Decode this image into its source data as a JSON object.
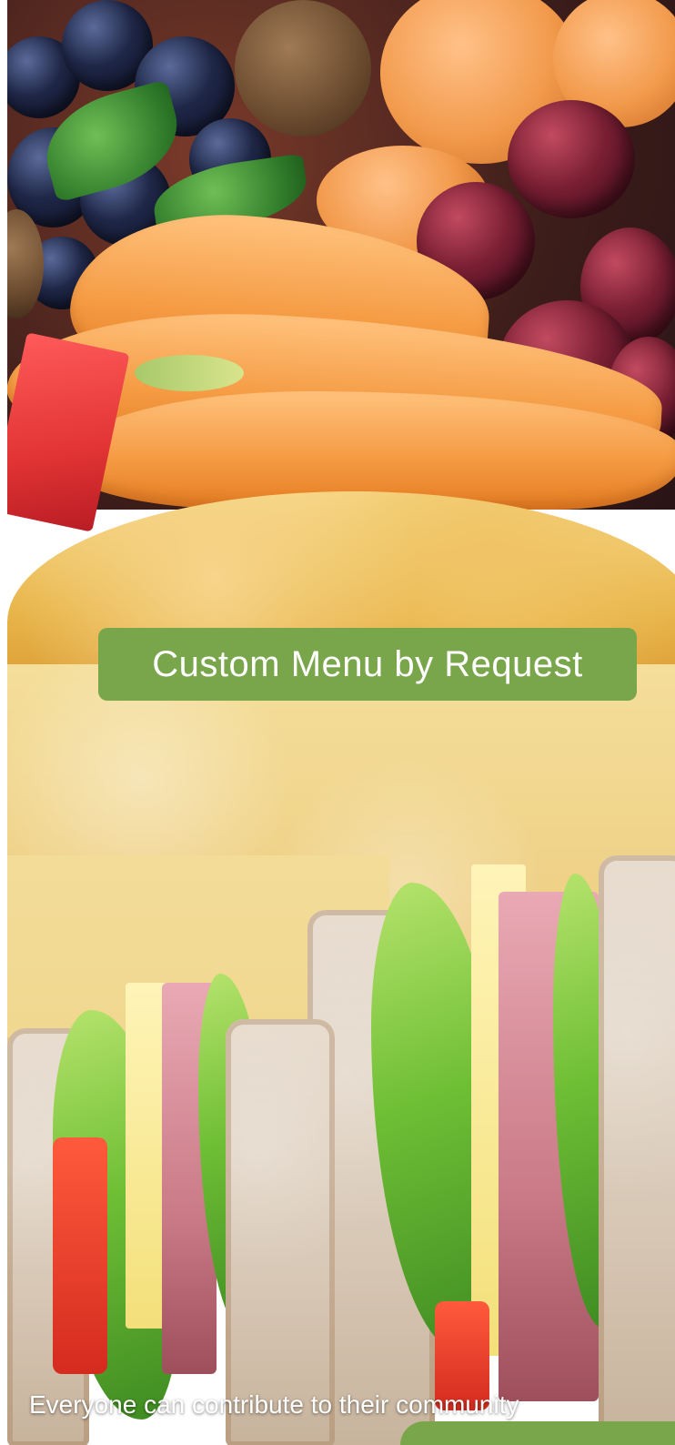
{
  "banner": {
    "title": "Custom Menu by Request"
  },
  "footer": {
    "tagline": "Everyone can contribute to their community"
  },
  "colors": {
    "accent_green": "#79a64b",
    "text_on_accent": "#ffffff"
  },
  "hero": {
    "image_subject": "fruit platter, biscuit and ham sandwich collage"
  }
}
